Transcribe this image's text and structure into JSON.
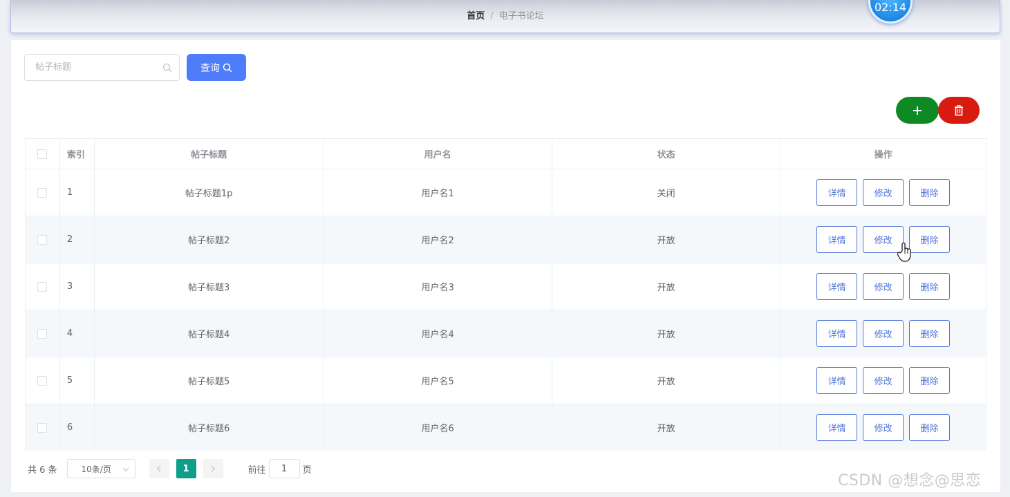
{
  "header": {
    "breadcrumb": {
      "home": "首页",
      "separator": "/",
      "current": "电子书论坛"
    },
    "clock": "02:14"
  },
  "search": {
    "placeholder": "帖子标题",
    "value": "",
    "button_label": "查询",
    "icon": "search-icon"
  },
  "actions": {
    "add_icon": "plus-icon",
    "delete_icon": "trash-icon",
    "add_color": "#0e8a24",
    "delete_color": "#d81b10"
  },
  "table": {
    "columns": [
      "索引",
      "帖子标题",
      "用户名",
      "状态",
      "操作"
    ],
    "rows": [
      {
        "index": "1",
        "title": "帖子标题1p",
        "username": "用户名1",
        "status": "关闭"
      },
      {
        "index": "2",
        "title": "帖子标题2",
        "username": "用户名2",
        "status": "开放"
      },
      {
        "index": "3",
        "title": "帖子标题3",
        "username": "用户名3",
        "status": "开放"
      },
      {
        "index": "4",
        "title": "帖子标题4",
        "username": "用户名4",
        "status": "开放"
      },
      {
        "index": "5",
        "title": "帖子标题5",
        "username": "用户名5",
        "status": "开放"
      },
      {
        "index": "6",
        "title": "帖子标题6",
        "username": "用户名6",
        "status": "开放"
      }
    ],
    "row_actions": {
      "detail": "详情",
      "edit": "修改",
      "delete": "删除"
    }
  },
  "pagination": {
    "total_text": "共 6 条",
    "page_size": "10条/页",
    "current_page": "1",
    "goto_label": "前往",
    "goto_value": "1",
    "page_suffix": "页"
  },
  "watermark": "CSDN @想念@思恋",
  "colors": {
    "primary": "#4f7cfa",
    "page_active": "#0f9e8a",
    "op_border": "#4f74d8"
  }
}
